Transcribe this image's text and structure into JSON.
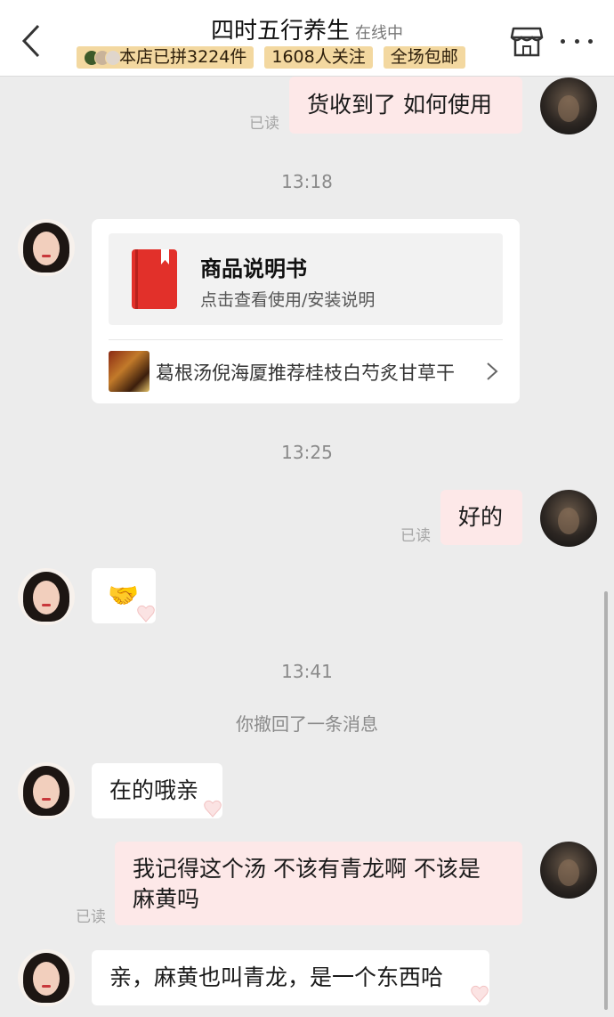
{
  "header": {
    "title": "四时五行养生",
    "status": "在线中",
    "badges": [
      "本店已拼3224件",
      "1608人关注",
      "全场包邮"
    ]
  },
  "messages": {
    "m1": {
      "text": "货收到了 如何使用",
      "read": "已读"
    },
    "time1": "13:18",
    "card": {
      "title": "商品说明书",
      "subtitle": "点击查看使用/安装说明",
      "product": "葛根汤倪海厦推荐桂枝白芍炙甘草干"
    },
    "time2": "13:25",
    "m2": {
      "text": "好的",
      "read": "已读"
    },
    "m3": {
      "emoji": "🤝"
    },
    "time3": "13:41",
    "recall": "你撤回了一条消息",
    "m4": {
      "text": "在的哦亲"
    },
    "m5": {
      "line1": "我记得这个汤 不该有青龙啊 不该是",
      "line2": "麻黄吗",
      "read": "已读"
    },
    "m6": {
      "text": "亲，麻黄也叫青龙，是一个东西哈"
    }
  },
  "colors": {
    "user_bubble": "#fde8e8",
    "agent_bubble": "#ffffff",
    "badge": "#f3d8a0",
    "background": "#ececec"
  },
  "icons": [
    "back-arrow-icon",
    "store-icon",
    "more-icon",
    "book-icon",
    "chevron-right-icon",
    "heart-pin-icon"
  ]
}
